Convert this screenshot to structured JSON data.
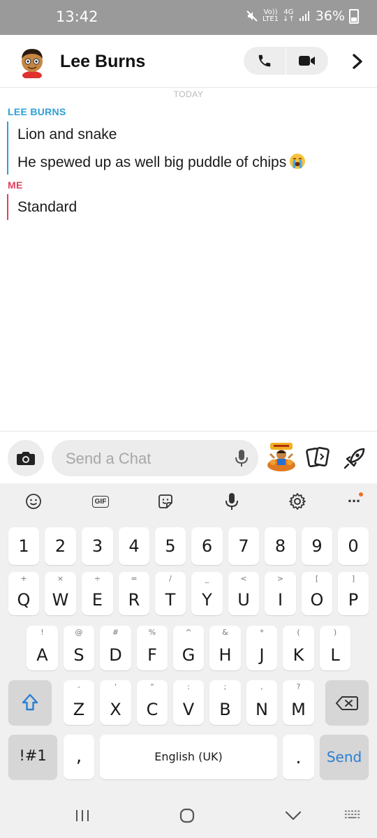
{
  "status_bar": {
    "time": "13:42",
    "network_line1": "Vo))",
    "network_line2": "LTE1",
    "network_type": "4G",
    "battery": "36%"
  },
  "header": {
    "contact_name": "Lee Burns",
    "icons": [
      "avatar-bitmoji",
      "phone-icon",
      "video-icon",
      "chevron-right-icon"
    ]
  },
  "chat": {
    "date_divider": "TODAY",
    "groups": [
      {
        "sender": "LEE BURNS",
        "color": "#2c9fd6",
        "messages": [
          "Lion and snake",
          "He spewed up as well big puddle of chips"
        ]
      },
      {
        "sender": "ME",
        "color": "#e0405e",
        "messages": [
          "Standard"
        ]
      }
    ]
  },
  "input_bar": {
    "placeholder": "Send a Chat",
    "icons": [
      "camera-icon",
      "mic-icon",
      "bitmoji-sticker",
      "cards-icon",
      "rocket-icon"
    ]
  },
  "keyboard": {
    "toolbar": {
      "gif_label": "GIF",
      "more_label": "..."
    },
    "number_row": [
      "1",
      "2",
      "3",
      "4",
      "5",
      "6",
      "7",
      "8",
      "9",
      "0"
    ],
    "row1": {
      "keys": [
        "Q",
        "W",
        "E",
        "R",
        "T",
        "Y",
        "U",
        "I",
        "O",
        "P"
      ],
      "hints": [
        "+",
        "×",
        "÷",
        "=",
        "/",
        "_",
        "<",
        ">",
        "[",
        "]"
      ]
    },
    "row2": {
      "keys": [
        "A",
        "S",
        "D",
        "F",
        "G",
        "H",
        "J",
        "K",
        "L"
      ],
      "hints": [
        "!",
        "@",
        "#",
        "%",
        "^",
        "&",
        "*",
        "(",
        ")"
      ]
    },
    "row3": {
      "keys": [
        "Z",
        "X",
        "C",
        "V",
        "B",
        "N",
        "M"
      ],
      "hints": [
        "-",
        "'",
        "\"",
        ":",
        ";",
        ",",
        "?"
      ]
    },
    "symbols_key": "!#1",
    "comma_key": ",",
    "space_label": "English (UK)",
    "period_key": ".",
    "send_label": "Send",
    "accent_color": "#2a7fd4"
  },
  "nav_bar": {
    "icons": [
      "recents-icon",
      "home-icon",
      "back-icon",
      "keyboard-hide-icon"
    ]
  }
}
